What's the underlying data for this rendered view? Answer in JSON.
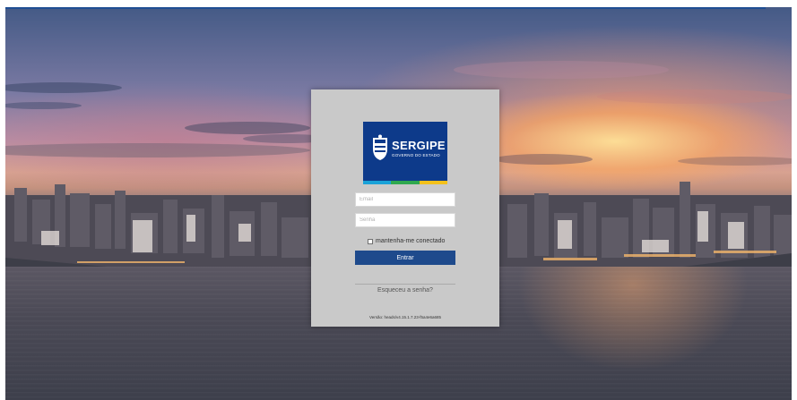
{
  "background": {
    "description_colors": {
      "sky_top": "#445a86",
      "sunset": "#ffe196",
      "water": "#4a4955"
    },
    "topline_color": "#1f4e93"
  },
  "logo": {
    "title": "SERGIPE",
    "subtitle": "GOVERNO DO ESTADO",
    "background_color": "#0d3a8a",
    "stripe_colors": [
      "#1aa2d8",
      "#2fa84f",
      "#f3c11b"
    ]
  },
  "form": {
    "email_placeholder": "Email",
    "password_placeholder": "Senha",
    "remember_label": "mantenha-me conectado",
    "remember_checked": false,
    "submit_label": "Entrar",
    "submit_color": "#1e4a8c",
    "forgot_link": "Esqueceu a senha?"
  },
  "version_text": "Versão: heads/v4.15.1.7.23-f5a4e6a685"
}
